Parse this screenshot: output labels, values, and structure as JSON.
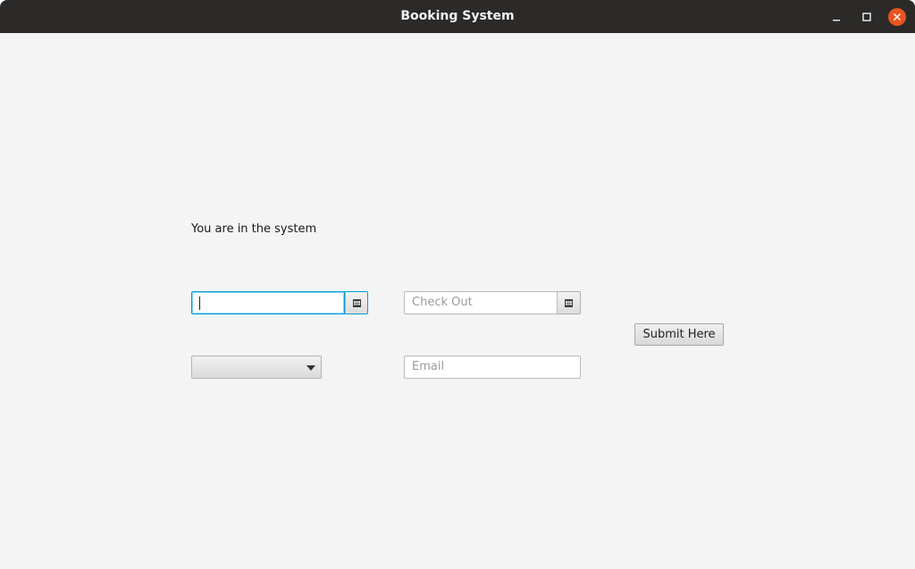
{
  "window": {
    "title": "Booking System"
  },
  "titlebar_buttons": {
    "minimize_icon": "minimize-icon",
    "maximize_icon": "maximize-icon",
    "close_icon": "close-icon",
    "close_color": "#e95420"
  },
  "form": {
    "status_text": "You are in the system",
    "check_in": {
      "value": "",
      "placeholder": "",
      "icon": "calendar-icon"
    },
    "check_out": {
      "value": "",
      "placeholder": "Check Out",
      "icon": "calendar-icon"
    },
    "combo": {
      "selected": "",
      "icon": "chevron-down-icon"
    },
    "email": {
      "value": "",
      "placeholder": "Email"
    },
    "submit_label": "Submit Here"
  },
  "colors": {
    "focus_accent": "#039ed3",
    "background": "#f4f4f4",
    "titlebar": "#2b2a29"
  }
}
